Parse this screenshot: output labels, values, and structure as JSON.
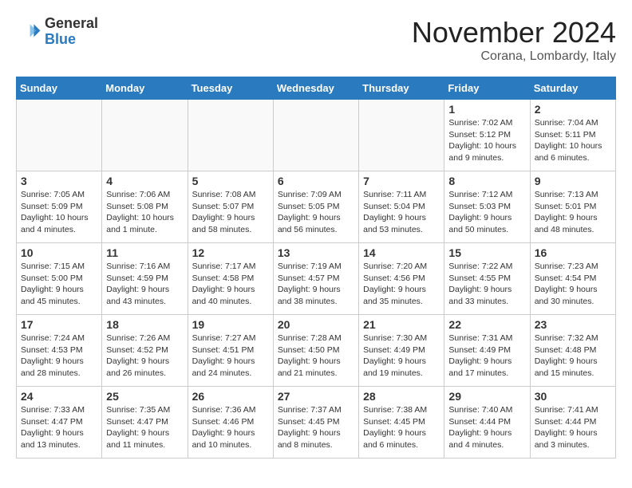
{
  "logo": {
    "general": "General",
    "blue": "Blue"
  },
  "title": "November 2024",
  "subtitle": "Corana, Lombardy, Italy",
  "days_header": [
    "Sunday",
    "Monday",
    "Tuesday",
    "Wednesday",
    "Thursday",
    "Friday",
    "Saturday"
  ],
  "weeks": [
    [
      {
        "day": "",
        "info": ""
      },
      {
        "day": "",
        "info": ""
      },
      {
        "day": "",
        "info": ""
      },
      {
        "day": "",
        "info": ""
      },
      {
        "day": "",
        "info": ""
      },
      {
        "day": "1",
        "info": "Sunrise: 7:02 AM\nSunset: 5:12 PM\nDaylight: 10 hours\nand 9 minutes."
      },
      {
        "day": "2",
        "info": "Sunrise: 7:04 AM\nSunset: 5:11 PM\nDaylight: 10 hours\nand 6 minutes."
      }
    ],
    [
      {
        "day": "3",
        "info": "Sunrise: 7:05 AM\nSunset: 5:09 PM\nDaylight: 10 hours\nand 4 minutes."
      },
      {
        "day": "4",
        "info": "Sunrise: 7:06 AM\nSunset: 5:08 PM\nDaylight: 10 hours\nand 1 minute."
      },
      {
        "day": "5",
        "info": "Sunrise: 7:08 AM\nSunset: 5:07 PM\nDaylight: 9 hours\nand 58 minutes."
      },
      {
        "day": "6",
        "info": "Sunrise: 7:09 AM\nSunset: 5:05 PM\nDaylight: 9 hours\nand 56 minutes."
      },
      {
        "day": "7",
        "info": "Sunrise: 7:11 AM\nSunset: 5:04 PM\nDaylight: 9 hours\nand 53 minutes."
      },
      {
        "day": "8",
        "info": "Sunrise: 7:12 AM\nSunset: 5:03 PM\nDaylight: 9 hours\nand 50 minutes."
      },
      {
        "day": "9",
        "info": "Sunrise: 7:13 AM\nSunset: 5:01 PM\nDaylight: 9 hours\nand 48 minutes."
      }
    ],
    [
      {
        "day": "10",
        "info": "Sunrise: 7:15 AM\nSunset: 5:00 PM\nDaylight: 9 hours\nand 45 minutes."
      },
      {
        "day": "11",
        "info": "Sunrise: 7:16 AM\nSunset: 4:59 PM\nDaylight: 9 hours\nand 43 minutes."
      },
      {
        "day": "12",
        "info": "Sunrise: 7:17 AM\nSunset: 4:58 PM\nDaylight: 9 hours\nand 40 minutes."
      },
      {
        "day": "13",
        "info": "Sunrise: 7:19 AM\nSunset: 4:57 PM\nDaylight: 9 hours\nand 38 minutes."
      },
      {
        "day": "14",
        "info": "Sunrise: 7:20 AM\nSunset: 4:56 PM\nDaylight: 9 hours\nand 35 minutes."
      },
      {
        "day": "15",
        "info": "Sunrise: 7:22 AM\nSunset: 4:55 PM\nDaylight: 9 hours\nand 33 minutes."
      },
      {
        "day": "16",
        "info": "Sunrise: 7:23 AM\nSunset: 4:54 PM\nDaylight: 9 hours\nand 30 minutes."
      }
    ],
    [
      {
        "day": "17",
        "info": "Sunrise: 7:24 AM\nSunset: 4:53 PM\nDaylight: 9 hours\nand 28 minutes."
      },
      {
        "day": "18",
        "info": "Sunrise: 7:26 AM\nSunset: 4:52 PM\nDaylight: 9 hours\nand 26 minutes."
      },
      {
        "day": "19",
        "info": "Sunrise: 7:27 AM\nSunset: 4:51 PM\nDaylight: 9 hours\nand 24 minutes."
      },
      {
        "day": "20",
        "info": "Sunrise: 7:28 AM\nSunset: 4:50 PM\nDaylight: 9 hours\nand 21 minutes."
      },
      {
        "day": "21",
        "info": "Sunrise: 7:30 AM\nSunset: 4:49 PM\nDaylight: 9 hours\nand 19 minutes."
      },
      {
        "day": "22",
        "info": "Sunrise: 7:31 AM\nSunset: 4:49 PM\nDaylight: 9 hours\nand 17 minutes."
      },
      {
        "day": "23",
        "info": "Sunrise: 7:32 AM\nSunset: 4:48 PM\nDaylight: 9 hours\nand 15 minutes."
      }
    ],
    [
      {
        "day": "24",
        "info": "Sunrise: 7:33 AM\nSunset: 4:47 PM\nDaylight: 9 hours\nand 13 minutes."
      },
      {
        "day": "25",
        "info": "Sunrise: 7:35 AM\nSunset: 4:47 PM\nDaylight: 9 hours\nand 11 minutes."
      },
      {
        "day": "26",
        "info": "Sunrise: 7:36 AM\nSunset: 4:46 PM\nDaylight: 9 hours\nand 10 minutes."
      },
      {
        "day": "27",
        "info": "Sunrise: 7:37 AM\nSunset: 4:45 PM\nDaylight: 9 hours\nand 8 minutes."
      },
      {
        "day": "28",
        "info": "Sunrise: 7:38 AM\nSunset: 4:45 PM\nDaylight: 9 hours\nand 6 minutes."
      },
      {
        "day": "29",
        "info": "Sunrise: 7:40 AM\nSunset: 4:44 PM\nDaylight: 9 hours\nand 4 minutes."
      },
      {
        "day": "30",
        "info": "Sunrise: 7:41 AM\nSunset: 4:44 PM\nDaylight: 9 hours\nand 3 minutes."
      }
    ]
  ]
}
